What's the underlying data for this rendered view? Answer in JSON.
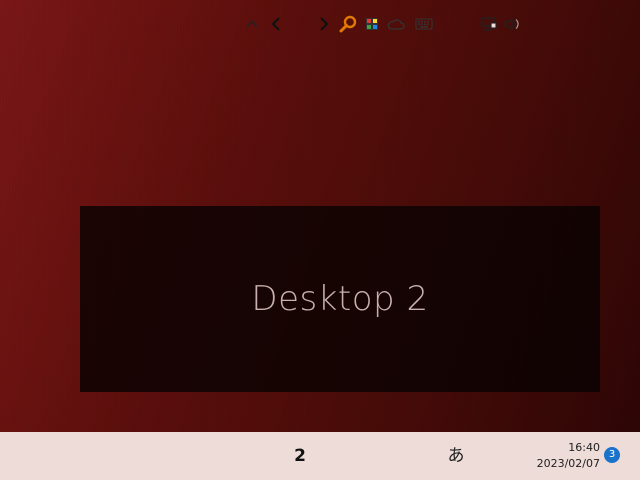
{
  "desktop": {
    "overlay_label": "Desktop 2"
  },
  "taskbar": {
    "current_desktop": "2",
    "ime_indicator": "あ",
    "clock": {
      "time": "16:40",
      "date": "2023/02/07"
    },
    "notification_count": "3",
    "icons": [
      "chevron-up-icon",
      "chevron-left-icon",
      "chevron-right-icon",
      "search-magnifier-icon",
      "color-palette-icon",
      "onedrive-cloud-icon",
      "keyboard-icon",
      "network-icon",
      "volume-icon"
    ]
  },
  "colors": {
    "taskbar_bg": "#eddcd8",
    "notification_badge": "#1a73c9",
    "search_icon": "#e07a00"
  }
}
